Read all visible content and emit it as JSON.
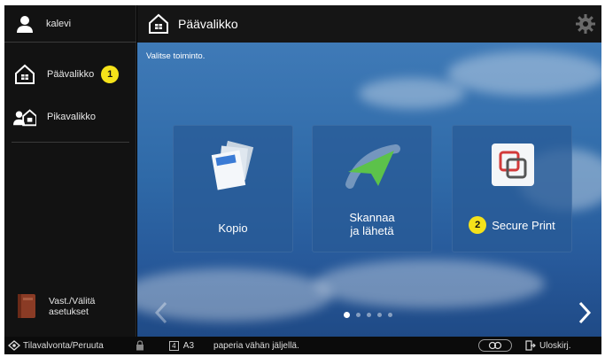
{
  "user": {
    "name": "kalevi"
  },
  "sidebar": {
    "items": [
      {
        "label": "Päävalikko",
        "badge": "1"
      },
      {
        "label": "Pikavalikko"
      }
    ],
    "settings": {
      "line1": "Vast./Välitä",
      "line2": "asetukset"
    }
  },
  "header": {
    "title": "Päävalikko"
  },
  "main": {
    "instruction": "Valitse toiminto.",
    "tiles": [
      {
        "label": "Kopio"
      },
      {
        "label_line1": "Skannaa",
        "label_line2": "ja lähetä"
      },
      {
        "label": "Secure Print",
        "badge": "2"
      }
    ],
    "pager": {
      "pages": 5,
      "current": 1
    }
  },
  "statusbar": {
    "status_label": "Tilavalvonta/Peruuta",
    "tray": "4",
    "paper_size": "A3",
    "message": "paperia vähän jäljellä.",
    "logout_label": "Uloskirj."
  },
  "colors": {
    "accent_badge": "#f5e21a",
    "sky": "#2f6aa8",
    "tile": "#285a96"
  },
  "icons": [
    "user-icon",
    "home-icon",
    "quick-menu-icon",
    "address-book-icon",
    "gear-icon",
    "copy-icon",
    "send-icon",
    "secure-print-icon",
    "chevron-left-icon",
    "chevron-right-icon",
    "status-monitor-icon",
    "lock-icon",
    "logout-icon"
  ]
}
